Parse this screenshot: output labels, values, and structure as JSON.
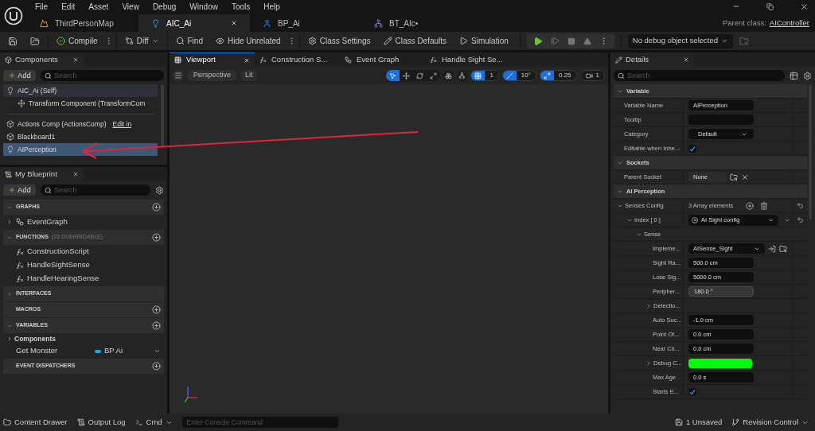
{
  "menu": [
    "File",
    "Edit",
    "Asset",
    "View",
    "Debug",
    "Window",
    "Tools",
    "Help"
  ],
  "document_tabs": [
    {
      "label": "ThirdPersonMap",
      "kind": "map",
      "selected": false
    },
    {
      "label": "AIC_Ai",
      "kind": "controller",
      "selected": true
    },
    {
      "label": "BP_Ai",
      "kind": "pawn",
      "selected": false
    },
    {
      "label": "BT_AIc•",
      "kind": "tree",
      "selected": false
    }
  ],
  "parent_class": {
    "label": "Parent class:",
    "value": "AIController"
  },
  "toolbar": {
    "compile": "Compile",
    "diff": "Diff",
    "find": "Find",
    "hide_unrelated": "Hide Unrelated",
    "class_settings": "Class Settings",
    "class_defaults": "Class Defaults",
    "simulation": "Simulation",
    "debug_object": "No debug object selected"
  },
  "components": {
    "title": "Components",
    "add": "Add",
    "search_placeholder": "Search",
    "items": [
      {
        "label": "AIC_Ai (Self)",
        "kind": "root",
        "selected": false,
        "children": [
          {
            "label": "Transform Component (TransformCom",
            "kind": "transform",
            "selected": false
          }
        ]
      },
      {
        "label": "Actions Comp (ActionsComp)",
        "kind": "component",
        "selected": false,
        "link": "Edit in"
      },
      {
        "label": "Blackboard1",
        "kind": "component",
        "selected": false
      },
      {
        "label": "AIPerception",
        "kind": "perception",
        "selected": true
      }
    ]
  },
  "my_blueprint": {
    "title": "My Blueprint",
    "add": "Add",
    "search_placeholder": "Search",
    "sections": [
      {
        "title": "GRAPHS",
        "expanded": true,
        "add": true,
        "items": [
          {
            "label": "EventGraph",
            "kind": "graph"
          }
        ]
      },
      {
        "title": "FUNCTIONS",
        "note": "(23 OVERRIDABLE)",
        "expanded": true,
        "add": true,
        "items": [
          {
            "label": "ConstructionScript",
            "kind": "construction"
          },
          {
            "label": "HandleSightSense",
            "kind": "function"
          },
          {
            "label": "HandleHearingSense",
            "kind": "function"
          }
        ]
      },
      {
        "title": "INTERFACES",
        "expanded": false,
        "add": false
      },
      {
        "title": "MACROS",
        "add": true
      },
      {
        "title": "VARIABLES",
        "expanded": true,
        "add": true,
        "items": [
          {
            "label": "Components",
            "kind": "category"
          },
          {
            "label": "Get Monster",
            "kind": "variable",
            "type": "BP Ai",
            "color": "#1aa7ec"
          }
        ]
      },
      {
        "title": "EVENT DISPATCHERS",
        "add": true
      }
    ]
  },
  "graph_tabs": [
    {
      "label": "Viewport",
      "kind": "viewport",
      "selected": true
    },
    {
      "label": "Construction S...",
      "kind": "function",
      "selected": false
    },
    {
      "label": "Event Graph",
      "kind": "graph",
      "selected": false
    },
    {
      "label": "Handle Sight Se...",
      "kind": "function",
      "selected": false
    }
  ],
  "viewport": {
    "perspective": "Perspective",
    "lit": "Lit",
    "tools": [
      {
        "kind": "select",
        "selected": true
      },
      {
        "kind": "move",
        "selected": false
      },
      {
        "kind": "rotate",
        "selected": false
      },
      {
        "kind": "scale",
        "selected": false
      }
    ],
    "grid_snap": {
      "on": true,
      "value": "1"
    },
    "rotation_snap": {
      "on": true,
      "value": "10°"
    },
    "scale_snap": {
      "on": true,
      "value": "0.25"
    },
    "camera_speed": "1"
  },
  "details": {
    "title": "Details",
    "search_placeholder": "Search",
    "sections": [
      {
        "title": "Variable",
        "expanded": true,
        "rows": [
          {
            "label": "Variable Name",
            "kind": "text",
            "value": "AIPerception"
          },
          {
            "label": "Tooltip",
            "kind": "text"
          },
          {
            "label": "Category",
            "kind": "combo",
            "value": "Default"
          },
          {
            "label": "Editable when Inhe...",
            "kind": "checkbox",
            "checked": true
          }
        ]
      },
      {
        "title": "Sockets",
        "expanded": true,
        "rows": [
          {
            "label": "Parent Socket",
            "kind": "socket",
            "value": "None"
          }
        ]
      },
      {
        "title": "AI Perception",
        "expanded": true,
        "rows": [
          {
            "label": "Senses Config",
            "kind": "array",
            "value": "3 Array elements",
            "expanded": true,
            "children": [
              {
                "label": "Index [ 0 ]",
                "kind": "select",
                "value": "AI Sight config",
                "expanded": true,
                "children": [
                  {
                    "label": "Sense",
                    "kind": "group",
                    "expanded": true,
                    "children": [
                      {
                        "label": "Impleme...",
                        "kind": "class",
                        "value": "AISense_Sight"
                      },
                      {
                        "label": "Sight Ra...",
                        "kind": "text",
                        "value": "500.0 cm"
                      },
                      {
                        "label": "Lose Sig...",
                        "kind": "text",
                        "value": "5000.0 cm"
                      },
                      {
                        "label": "Peripher...",
                        "kind": "spin",
                        "value": "180.0 °"
                      },
                      {
                        "label": "Detectio...",
                        "kind": "struct",
                        "expanded": false
                      },
                      {
                        "label": "Auto Suc...",
                        "kind": "text",
                        "value": "-1.0 cm"
                      },
                      {
                        "label": "Point Of...",
                        "kind": "text",
                        "value": "0.0 cm"
                      },
                      {
                        "label": "Near Cli...",
                        "kind": "text",
                        "value": "0.0 cm"
                      },
                      {
                        "label": "Debug C...",
                        "kind": "color",
                        "color": "#00ff00",
                        "expanded": false
                      },
                      {
                        "label": "Max Age",
                        "kind": "text",
                        "value": "0.0 s"
                      },
                      {
                        "label": "Starts E...",
                        "kind": "checkbox",
                        "checked": true
                      }
                    ]
                  }
                ]
              }
            ]
          }
        ]
      }
    ]
  },
  "status_bar": {
    "content_drawer": "Content Drawer",
    "output_log": "Output Log",
    "cmd": "Cmd",
    "console_placeholder": "Enter Console Command",
    "unsaved": "1 Unsaved",
    "revision_control": "Revision Control"
  }
}
